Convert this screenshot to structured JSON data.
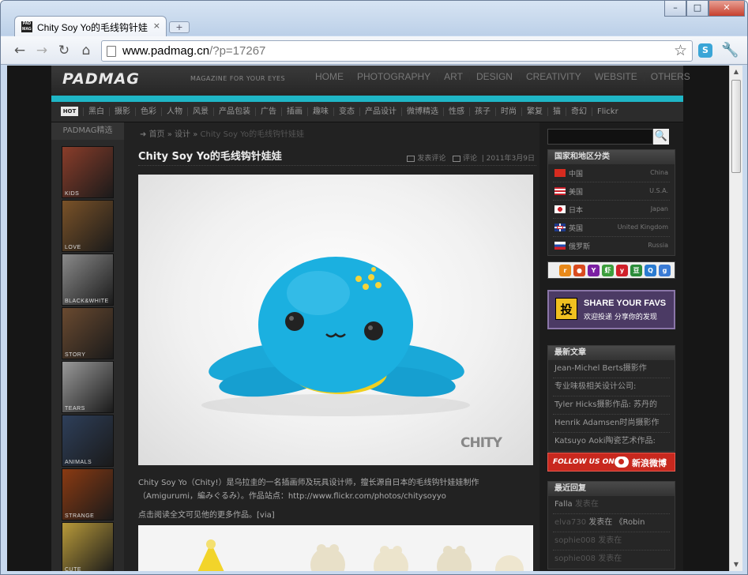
{
  "browser": {
    "tab_title": "Chity Soy Yo的毛线钩针娃娃",
    "tab_close": "×",
    "new_tab": "+",
    "favicon_text": "PAD MAG",
    "controls": {
      "minimize": "–",
      "maximize": "□",
      "close": "✕"
    },
    "nav": {
      "back": "←",
      "forward": "→",
      "reload": "↻",
      "home": "⌂"
    },
    "url_host": "www.padmag.cn",
    "url_path": "/?p=17267",
    "star": "☆",
    "menu_icon": "🔧",
    "ext_icon": "S"
  },
  "site": {
    "logo": "PADMAG",
    "tagline": "MAGAZINE FOR YOUR EYES",
    "main_nav": [
      "HOME",
      "PHOTOGRAPHY",
      "ART",
      "DESIGN",
      "CREATIVITY",
      "WEBSITE",
      "OTHERS"
    ],
    "hot_badge": "HOT",
    "categories": [
      "黑白",
      "摄影",
      "色彩",
      "人物",
      "风景",
      "产品包装",
      "广告",
      "插画",
      "趣味",
      "变态",
      "产品设计",
      "微博精选",
      "性感",
      "孩子",
      "时尚",
      "繁复",
      "猫",
      "奇幻",
      "Flickr"
    ]
  },
  "left": {
    "header": "PADMAG精选",
    "thumbs": [
      {
        "label": "KIDS",
        "color": "#8a3d2a"
      },
      {
        "label": "LOVE",
        "color": "#7a5228"
      },
      {
        "label": "BLACK&WHITE",
        "color": "#8a8a8a"
      },
      {
        "label": "STORY",
        "color": "#6a4a30"
      },
      {
        "label": "TEARS",
        "color": "#9a9a9a"
      },
      {
        "label": "ANIMALS",
        "color": "#2e3f5a"
      },
      {
        "label": "STRANGE",
        "color": "#8a3a12"
      },
      {
        "label": "CUTE",
        "color": "#b89a3a"
      }
    ]
  },
  "article": {
    "breadcrumb_home": "首页",
    "breadcrumb_cat": "设计",
    "breadcrumb_title": "Chity Soy Yo的毛线钩针娃娃",
    "title": "Chity Soy Yo的毛线钩针娃娃",
    "post_comment": "发表评论",
    "comments": "评论",
    "date": "2011年3月9日",
    "image_watermark": "CHITY",
    "desc_line1": "Chity Soy Yo（Chity!）是乌拉圭的一名插画师及玩具设计师，擅长源自日本的毛线钩针娃娃制作",
    "desc_line2": "（Amigurumi，編みぐるみ）。作品站点：http://www.flickr.com/photos/chitysoyyo",
    "read_more": "点击阅读全文可见他的更多作品。[via]"
  },
  "sidebar": {
    "search_button": "🔍",
    "regions_title": "国家和地区分类",
    "regions": [
      {
        "cn": "中国",
        "en": "China"
      },
      {
        "cn": "美国",
        "en": "U.S.A."
      },
      {
        "cn": "日本",
        "en": "Japan"
      },
      {
        "cn": "英国",
        "en": "United Kingdom"
      },
      {
        "cn": "俄罗斯",
        "en": "Russia"
      }
    ],
    "social_icons": [
      {
        "glyph": "r",
        "color": "#e8891a"
      },
      {
        "glyph": "●",
        "color": "#d94b1f"
      },
      {
        "glyph": "Y",
        "color": "#7b1fa2"
      },
      {
        "glyph": "虾",
        "color": "#3c9e3c"
      },
      {
        "glyph": "y",
        "color": "#d0202a"
      },
      {
        "glyph": "豆",
        "color": "#2a8c3a"
      },
      {
        "glyph": "Q",
        "color": "#2a7bd0"
      },
      {
        "glyph": "g",
        "color": "#3a7bd5"
      }
    ],
    "share_icon": "投",
    "share_title": "SHARE YOUR FAVS",
    "share_sub": "欢迎投递 分享你的发现",
    "recent_title": "最新文章",
    "recent": [
      "Jean-Michel Berts摄影作",
      "专业味极相关设计公司:",
      "Tyler Hicks摄影作品: 苏丹的",
      "Henrik Adamsen时尚摄影作",
      "Katsuyo Aoki陶瓷艺术作品:"
    ],
    "weibo_follow": "FOLLOW US ON",
    "weibo_name": "新浪微博",
    "comments_title": "最近回复",
    "recent_comments": [
      {
        "user": "Falla",
        "rest": "发表在"
      },
      {
        "user": "elva730",
        "rest": "发表在 《Robin"
      },
      {
        "user": "sophie008",
        "rest": "发表在"
      },
      {
        "user": "sophie008",
        "rest": "发表在"
      }
    ]
  }
}
